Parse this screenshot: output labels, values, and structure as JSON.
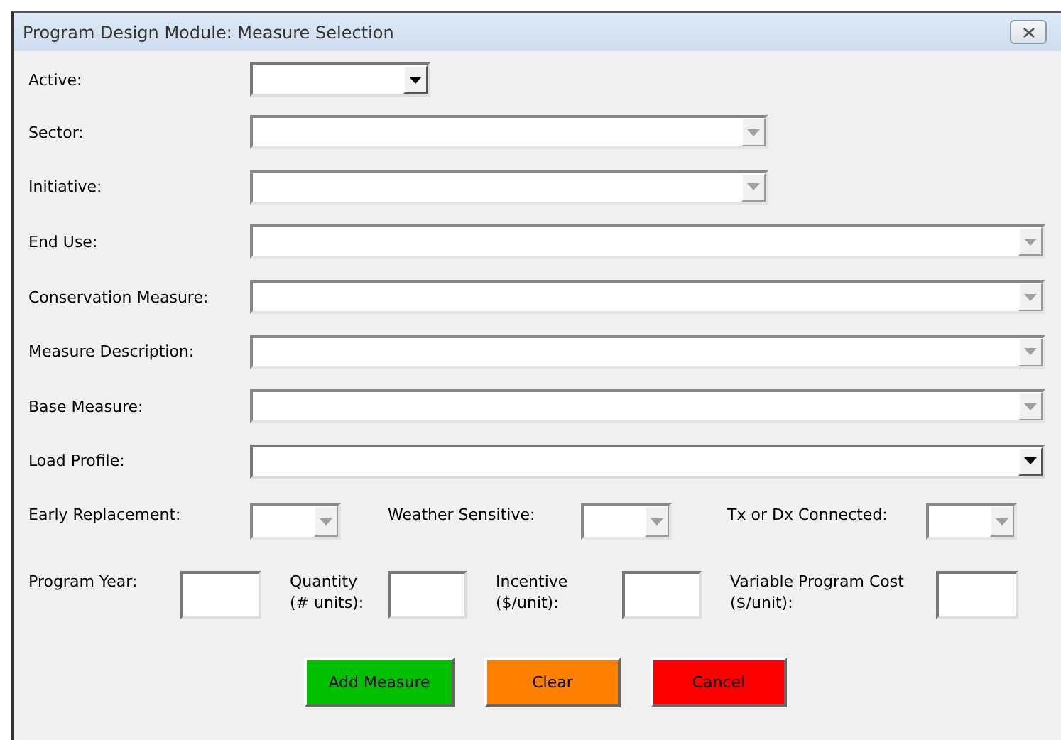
{
  "window": {
    "title": "Program Design Module: Measure Selection"
  },
  "dropdowns": [
    {
      "label": "Active:",
      "disabled": false
    },
    {
      "label": "Sector:",
      "disabled": true
    },
    {
      "label": "Initiative:",
      "disabled": true
    },
    {
      "label": "End Use:",
      "disabled": true
    },
    {
      "label": "Conservation Measure:",
      "disabled": true
    },
    {
      "label": "Measure Description:",
      "disabled": true
    },
    {
      "label": "Base Measure:",
      "disabled": true
    },
    {
      "label": "Load Profile:",
      "disabled": false
    }
  ],
  "flags": [
    {
      "label": "Early Replacement:",
      "disabled": true
    },
    {
      "label": "Weather Sensitive:",
      "disabled": true
    },
    {
      "label": "Tx or Dx Connected:",
      "disabled": true
    }
  ],
  "inputs": [
    {
      "label": [
        "Program Year:"
      ]
    },
    {
      "label": [
        "Quantity",
        "(# units):"
      ]
    },
    {
      "label": [
        "Incentive",
        "($/unit):"
      ]
    },
    {
      "label": [
        "Variable Program Cost",
        "($/unit):"
      ]
    }
  ],
  "buttons": [
    {
      "label": "Add Measure",
      "kind": "add"
    },
    {
      "label": "Clear",
      "kind": "clear"
    },
    {
      "label": "Cancel",
      "kind": "cancel"
    }
  ]
}
